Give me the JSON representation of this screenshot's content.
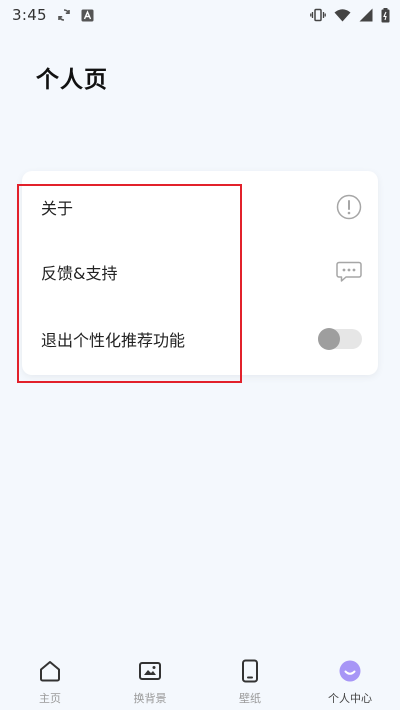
{
  "status_bar": {
    "time": "3:45",
    "icons": [
      "sync-icon",
      "a-icon",
      "vibrate-icon",
      "wifi-icon",
      "signal-icon",
      "battery-icon"
    ]
  },
  "page": {
    "title": "个人页"
  },
  "settings": {
    "items": [
      {
        "label": "关于",
        "icon": "info-circle-icon"
      },
      {
        "label": "反馈&支持",
        "icon": "chat-bubble-icon"
      },
      {
        "label": "退出个性化推荐功能",
        "control": "toggle",
        "enabled": false
      }
    ]
  },
  "tab_bar": {
    "tabs": [
      {
        "label": "主页",
        "icon": "home-icon",
        "active": false
      },
      {
        "label": "换背景",
        "icon": "picture-icon",
        "active": false
      },
      {
        "label": "壁纸",
        "icon": "phone-icon",
        "active": false
      },
      {
        "label": "个人中心",
        "icon": "smile-face-icon",
        "active": true
      }
    ]
  },
  "colors": {
    "background": "#f4f8fd",
    "accent": "#a796f6",
    "highlight_border": "#e2212b",
    "toggle_off": "#9e9e9e"
  }
}
